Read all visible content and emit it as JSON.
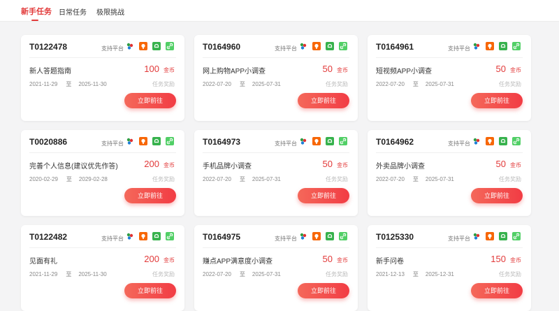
{
  "tabs": [
    "新手任务",
    "日常任务",
    "极限挑战"
  ],
  "platform_label": "支持平台",
  "date_separator": "至",
  "reward_type": "任务奖励",
  "unit": "金币",
  "button_label": "立即前往",
  "colors": {
    "accent": "#e23a3a",
    "button": "#f23c44"
  },
  "cards": [
    {
      "id": "T0122478",
      "name": "新人答题指南",
      "reward": "100",
      "start": "2021-11-29",
      "end": "2025-11-30"
    },
    {
      "id": "T0164960",
      "name": "网上购物APP小调查",
      "reward": "50",
      "start": "2022-07-20",
      "end": "2025-07-31"
    },
    {
      "id": "T0164961",
      "name": "短视频APP小调查",
      "reward": "50",
      "start": "2022-07-20",
      "end": "2025-07-31"
    },
    {
      "id": "T0020886",
      "name": "完善个人信息(建议优先作答)",
      "reward": "200",
      "start": "2020-02-29",
      "end": "2029-02-28"
    },
    {
      "id": "T0164973",
      "name": "手机品牌小调查",
      "reward": "50",
      "start": "2022-07-20",
      "end": "2025-07-31"
    },
    {
      "id": "T0164962",
      "name": "外卖品牌小调查",
      "reward": "50",
      "start": "2022-07-20",
      "end": "2025-07-31"
    },
    {
      "id": "T0122482",
      "name": "见面有礼",
      "reward": "200",
      "start": "2021-11-29",
      "end": "2025-11-30"
    },
    {
      "id": "T0164975",
      "name": "赚点APP满意度小调查",
      "reward": "50",
      "start": "2022-07-20",
      "end": "2025-07-31"
    },
    {
      "id": "T0125330",
      "name": "新手问卷",
      "reward": "150",
      "start": "2021-12-13",
      "end": "2025-12-31"
    }
  ]
}
